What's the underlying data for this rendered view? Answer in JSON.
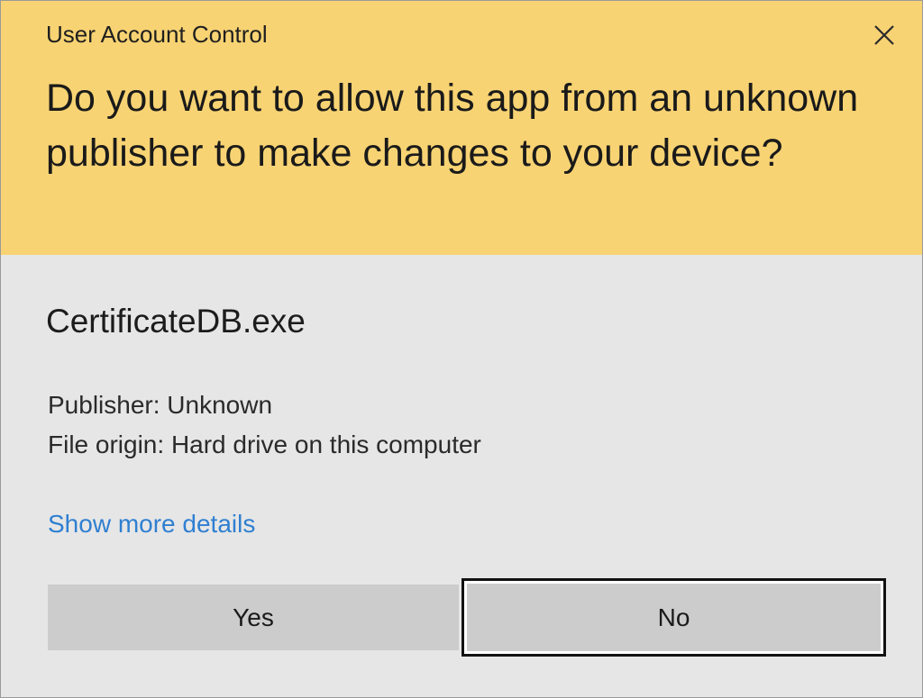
{
  "window": {
    "title": "User Account Control",
    "close_icon": "close-icon"
  },
  "prompt": {
    "question": "Do you want to allow this app from an unknown publisher to make changes to your device?"
  },
  "app": {
    "name": "CertificateDB.exe",
    "publisher": "Publisher: Unknown",
    "file_origin": "File origin: Hard drive on this computer"
  },
  "links": {
    "show_more": "Show more details"
  },
  "buttons": {
    "yes_label": "Yes",
    "no_label": "No"
  },
  "colors": {
    "header_background": "#f8d373",
    "body_background": "#e6e6e6",
    "link": "#2f7fd1",
    "button_background": "#cccccc"
  }
}
